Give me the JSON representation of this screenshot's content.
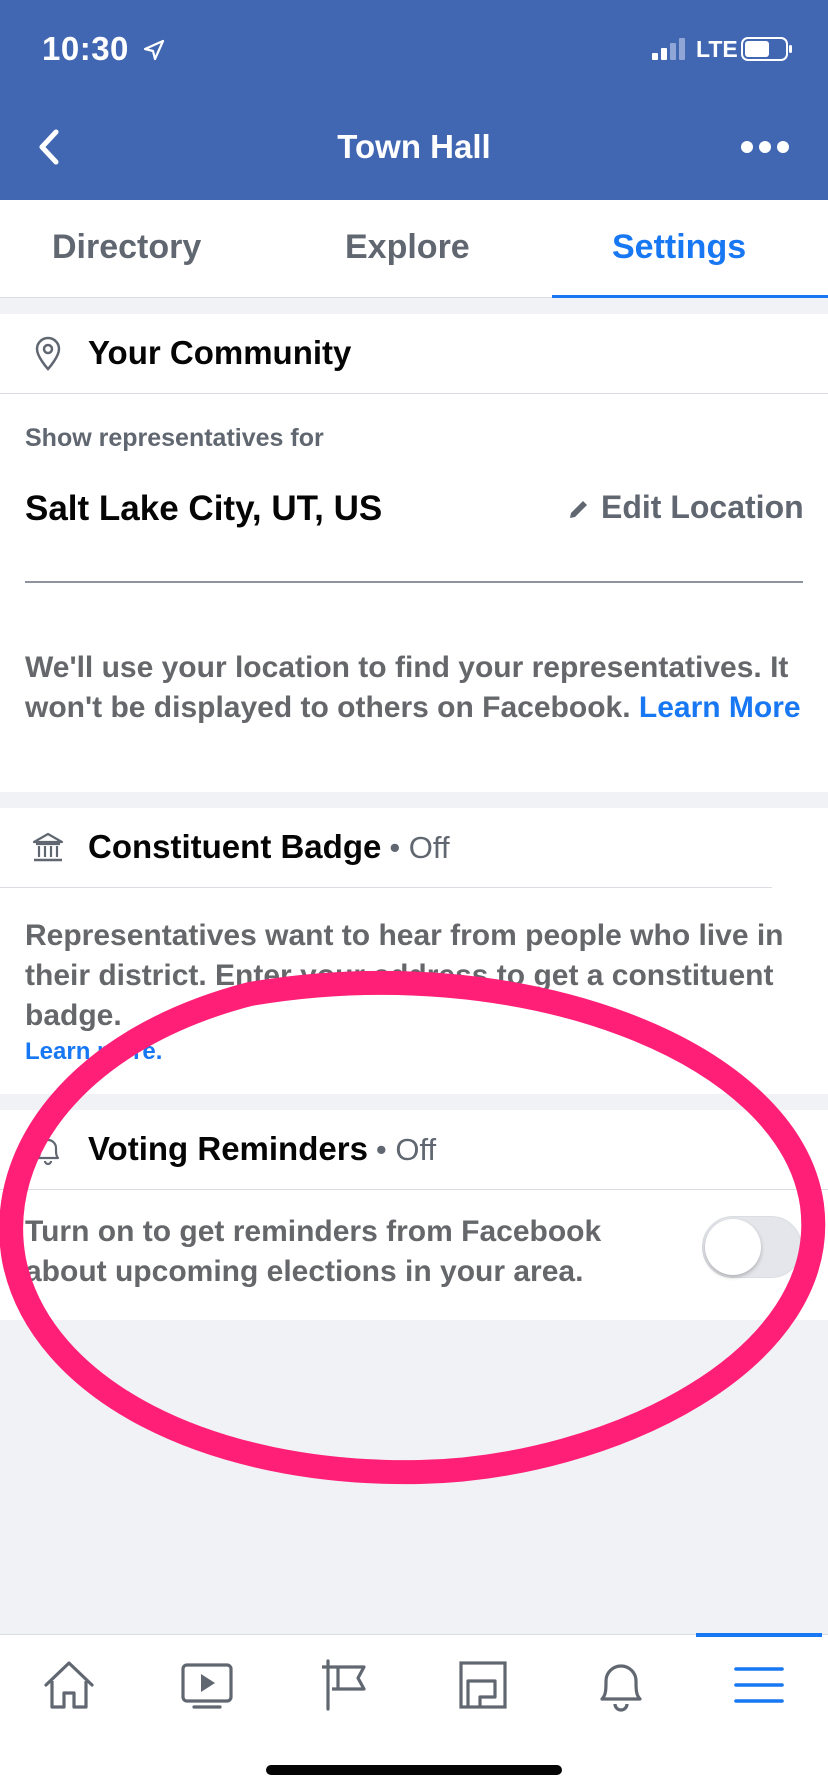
{
  "status_bar": {
    "time": "10:30",
    "network": "LTE"
  },
  "header": {
    "title": "Town Hall",
    "bg_color": "#4267b2"
  },
  "tabs": [
    {
      "label": "Directory",
      "active": false
    },
    {
      "label": "Explore",
      "active": false
    },
    {
      "label": "Settings",
      "active": true
    }
  ],
  "community": {
    "title": "Your Community",
    "show_label": "Show representatives for",
    "location": "Salt Lake City, UT, US",
    "edit_label": "Edit Location",
    "description": "We'll use your location to find your representatives. It won't be displayed to others on Facebook.",
    "learn_more": "Learn More"
  },
  "badge": {
    "title": "Constituent Badge",
    "status": "• Off",
    "description": "Representatives want to hear from people who live in their district. Enter your address to get a constituent badge.",
    "learn_more": "Learn more."
  },
  "reminders": {
    "title": "Voting Reminders",
    "status": "• Off",
    "description": "Turn on to get reminders from Facebook about upcoming elections in your area.",
    "toggle_on": false
  },
  "bottom_nav": [
    {
      "icon": "home-icon",
      "active": false
    },
    {
      "icon": "video-icon",
      "active": false
    },
    {
      "icon": "flag-icon",
      "active": false
    },
    {
      "icon": "marketplace-icon",
      "active": false
    },
    {
      "icon": "bell-icon",
      "active": false
    },
    {
      "icon": "menu-icon",
      "active": true
    }
  ],
  "colors": {
    "accent": "#1877f2",
    "annotation": "#ff1f77"
  }
}
